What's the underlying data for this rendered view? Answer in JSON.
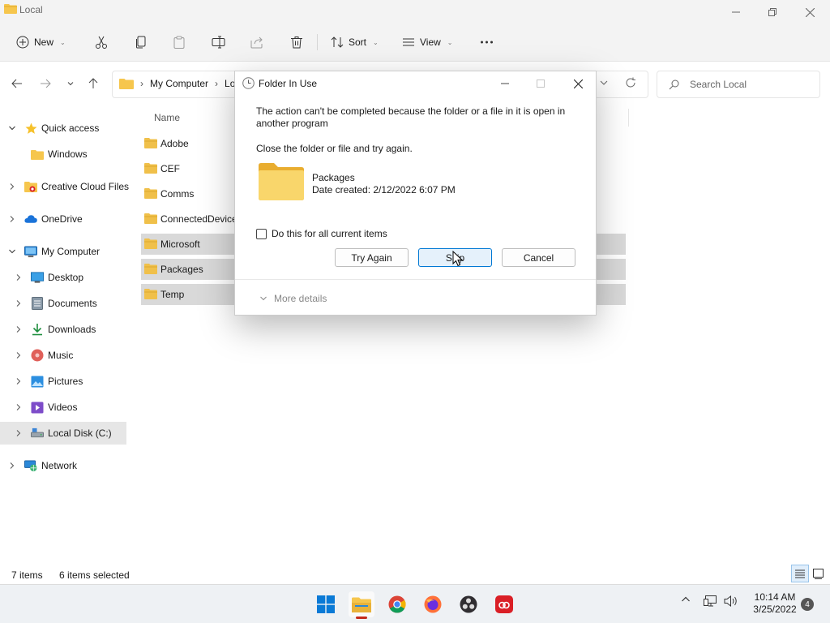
{
  "window": {
    "title": "Local"
  },
  "toolbar": {
    "new_label": "New",
    "sort_label": "Sort",
    "view_label": "View"
  },
  "address": {
    "crumbs": [
      "My Computer",
      "Lo"
    ],
    "search_placeholder": "Search Local"
  },
  "sidebar": {
    "items": [
      {
        "label": "Quick access",
        "icon": "star-icon"
      },
      {
        "label": "Windows",
        "icon": "folder-icon"
      },
      {
        "label": "Creative Cloud Files",
        "icon": "creative-cloud-folder-icon"
      },
      {
        "label": "OneDrive",
        "icon": "onedrive-cloud-icon"
      },
      {
        "label": "My Computer",
        "icon": "computer-icon"
      },
      {
        "label": "Desktop",
        "icon": "desktop-icon"
      },
      {
        "label": "Documents",
        "icon": "documents-icon"
      },
      {
        "label": "Downloads",
        "icon": "download-icon"
      },
      {
        "label": "Music",
        "icon": "music-icon"
      },
      {
        "label": "Pictures",
        "icon": "pictures-icon"
      },
      {
        "label": "Videos",
        "icon": "videos-icon"
      },
      {
        "label": "Local Disk (C:)",
        "icon": "drive-icon"
      },
      {
        "label": "Network",
        "icon": "network-icon"
      }
    ]
  },
  "filelist": {
    "column_name": "Name",
    "files": [
      {
        "name": "Adobe",
        "selected": false
      },
      {
        "name": "CEF",
        "selected": false
      },
      {
        "name": "Comms",
        "selected": false
      },
      {
        "name": "ConnectedDevice",
        "selected": false
      },
      {
        "name": "Microsoft",
        "selected": true
      },
      {
        "name": "Packages",
        "selected": true
      },
      {
        "name": "Temp",
        "selected": true
      }
    ]
  },
  "statusbar": {
    "item_count": "7 items",
    "selected_count": "6 items selected"
  },
  "dialog": {
    "title": "Folder In Use",
    "message": "The action can't be completed because the folder or a file in it is open in another program",
    "instruction": "Close the folder or file and try again.",
    "folder_name": "Packages",
    "folder_date": "Date created: 2/12/2022 6:07 PM",
    "checkbox_label": "Do this for all current items",
    "try_again_label": "Try Again",
    "skip_label": "Skip",
    "cancel_label": "Cancel",
    "more_details_label": "More details"
  },
  "taskbar": {
    "time": "10:14 AM",
    "date": "3/25/2022",
    "notification_count": "4"
  },
  "colors": {
    "accent": "#0078d4",
    "folder_yellow": "#f6c64d",
    "selection_gray": "#d9d9d9"
  }
}
